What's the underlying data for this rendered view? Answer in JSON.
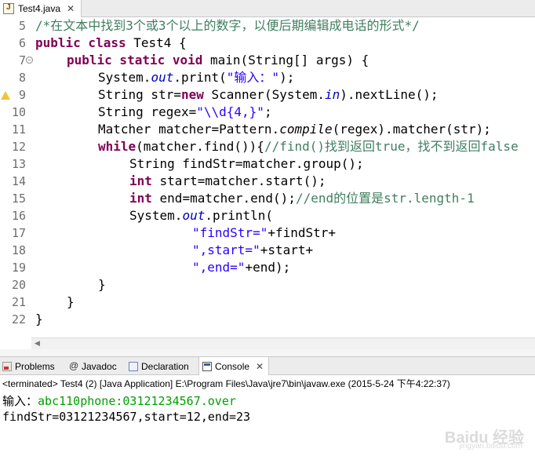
{
  "editor": {
    "tab_label": "Test4.java",
    "close_symbol": "✕"
  },
  "code": {
    "line_numbers": [
      "5",
      "6",
      "7",
      "8",
      "9",
      "10",
      "11",
      "12",
      "13",
      "14",
      "15",
      "16",
      "17",
      "18",
      "19",
      "20",
      "21",
      "22"
    ],
    "l5_comment": "/*在文本中找到3个或3个以上的数字，以便后期编辑成电话的形式*/",
    "l6_kw": "public class",
    "l6_rest": " Test4 {",
    "l7_kw": "public static void",
    "l7_rest": " main(String[] args) {",
    "l8_a": "System.",
    "l8_field": "out",
    "l8_b": ".print(",
    "l8_str": "\"输入：\"",
    "l8_c": ");",
    "l9_a": "String str=",
    "l9_kw": "new",
    "l9_b": " Scanner(System.",
    "l9_field": "in",
    "l9_c": ").nextLine();",
    "l10_a": "String regex=",
    "l10_str": "\"\\\\d{4,}\"",
    "l10_b": ";",
    "l11_a": "Matcher matcher=Pattern.",
    "l11_it": "compile",
    "l11_b": "(regex).matcher(str);",
    "l12_kw": "while",
    "l12_a": "(matcher.find()){",
    "l12_cm": "//find()找到返回true，找不到返回false",
    "l13": "String findStr=matcher.group();",
    "l14_kw": "int",
    "l14_rest": " start=matcher.start();",
    "l15_kw": "int",
    "l15_a": " end=matcher.end();",
    "l15_cm": "//end的位置是str.length-1",
    "l16_a": "System.",
    "l16_field": "out",
    "l16_b": ".println(",
    "l17_str": "\"findStr=\"",
    "l17_b": "+findStr+",
    "l18_str": "\",start=\"",
    "l18_b": "+start+",
    "l19_str": "\",end=\"",
    "l19_b": "+end);",
    "l20": "}",
    "l21": "}",
    "l22": "}"
  },
  "panel": {
    "tabs": {
      "problems": "Problems",
      "javadoc": "Javadoc",
      "declaration": "Declaration",
      "console": "Console"
    },
    "close_symbol": "✕",
    "status": "<terminated> Test4 (2) [Java Application] E:\\Program Files\\Java\\jre7\\bin\\javaw.exe (2015-5-24 下午4:22:37)",
    "output": {
      "prompt": "输入：",
      "input": "abc110phone:03121234567.over",
      "result": "findStr=03121234567,start=12,end=23"
    }
  },
  "watermark": {
    "text": "Baidu 经验",
    "url": "jingyan.baidu.com"
  }
}
